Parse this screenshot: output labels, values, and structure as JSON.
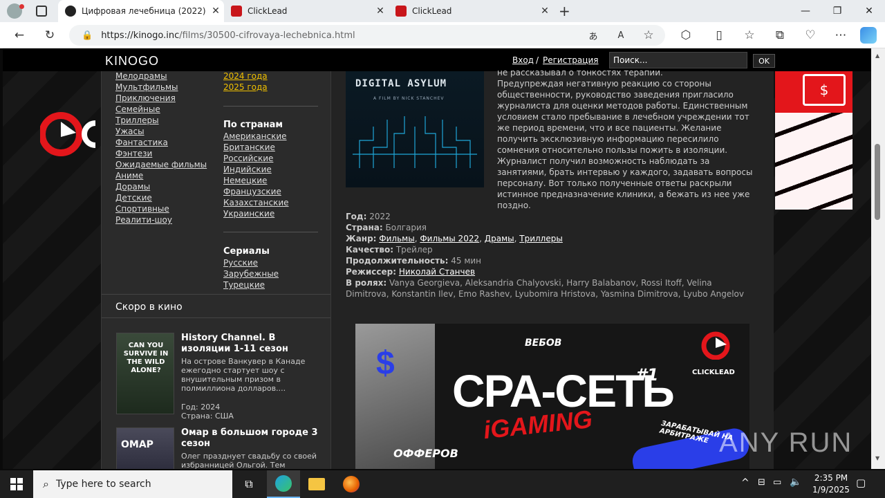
{
  "browser": {
    "tabs": [
      {
        "title": "Цифровая лечебница (2022) см",
        "favicon": "kinogo-favicon",
        "active": true
      },
      {
        "title": "ClickLead",
        "favicon": "clicklead-favicon",
        "active": false
      },
      {
        "title": "ClickLead",
        "favicon": "clicklead-favicon",
        "active": false
      }
    ],
    "url_host": "https://kinogo.inc",
    "url_path": "/films/30500-cifrovaya-lechebnica.html"
  },
  "site": {
    "logo": "KINOGO",
    "login": "Вход",
    "slash": "/",
    "register": "Регистрация",
    "search_placeholder": "Поиск...",
    "ok": "OK"
  },
  "genres": [
    "Мелодрамы",
    "Мультфильмы",
    "Приключения",
    "Семейные",
    "Триллеры",
    "Ужасы",
    "Фантастика",
    "Фэнтези",
    "Ожидаемые фильмы",
    "Аниме",
    "Дорамы",
    "Детские",
    "Спортивные",
    "Реалити-шоу"
  ],
  "years": [
    "2024 года",
    "2025 года"
  ],
  "countries": {
    "heading": "По странам",
    "items": [
      "Американские",
      "Британские",
      "Российские",
      "Индийские",
      "Немецкие",
      "Французские",
      "Казахстанские",
      "Украинские"
    ]
  },
  "series": {
    "heading": "Сериалы",
    "items": [
      "Русские",
      "Зарубежные",
      "Турецкие"
    ]
  },
  "soon": {
    "heading": "Скоро в кино",
    "items": [
      {
        "title": "History Channel. В изоляции 1-11 сезон",
        "desc": "На острове Ванкувер в Канаде ежегодно стартует шоу с внушительным призом в полмиллиона долларов....",
        "year": "Год: 2024",
        "country": "Страна: США",
        "poster_text": "CAN YOU SURVIVE IN THE WILD ALONE?"
      },
      {
        "title": "Омар в большом городе 3 сезон",
        "desc": "Олег празднует свадьбу со своей избранницей Ольгой. Тем временем",
        "poster_text": "ОМАР"
      }
    ]
  },
  "movie": {
    "poster_title": "DIGITAL ASYLUM",
    "poster_sub": "A FILM BY NICK STANCHEV",
    "description_top": "не рассказывал о тонкостях терапии.",
    "description": "Предупреждая негативную реакцию со стороны общественности, руководство заведения пригласило журналиста для оценки методов работы. Единственным условием стало пребывание в лечебном учреждении тот же период времени, что и все пациенты. Желание получить эксклюзивную информацию пересилило сомнения относительно пользы пожить в изоляции. Журналист получил возможность наблюдать за занятиями, брать интервью у каждого, задавать вопросы персоналу. Вот только полученные ответы раскрыли истинное предназначение клиники, а бежать из нее уже поздно.",
    "year_label": "Год:",
    "year": "2022",
    "country_label": "Страна:",
    "country": "Болгария",
    "genre_label": "Жанр:",
    "genres": [
      "Фильмы",
      "Фильмы 2022",
      "Драмы",
      "Триллеры"
    ],
    "quality_label": "Качество:",
    "quality": "Трейлер",
    "duration_label": "Продолжительность:",
    "duration": "45 мин",
    "director_label": "Режиссер:",
    "director": "Николай Станчев",
    "cast_label": "В ролях:",
    "cast": "Vanya Georgieva, Aleksandria Chalyovski, Harry Balabanov, Rossi Itoff, Velina Dimitrova, Konstantin Ilev, Emo Rashev, Lyubomira Hristova, Yasmina Dimitrova, Lyubo Angelov"
  },
  "ad": {
    "headline": "CPA-СЕТЬ",
    "num": "#1",
    "sub": "iGAMING",
    "brand": "CLICKLEAD",
    "webs": "ВЕБОВ",
    "offers": "ОФФЕРОВ",
    "earn": "ЗАРАБАТЫВАЙ НА АРБИТРАЖЕ"
  },
  "watermark": "ANY RUN",
  "taskbar": {
    "search_placeholder": "Type here to search",
    "time": "2:35 PM",
    "date": "1/9/2025"
  },
  "colors": {
    "accent": "#f0c000",
    "brand_red": "#e3161b"
  }
}
